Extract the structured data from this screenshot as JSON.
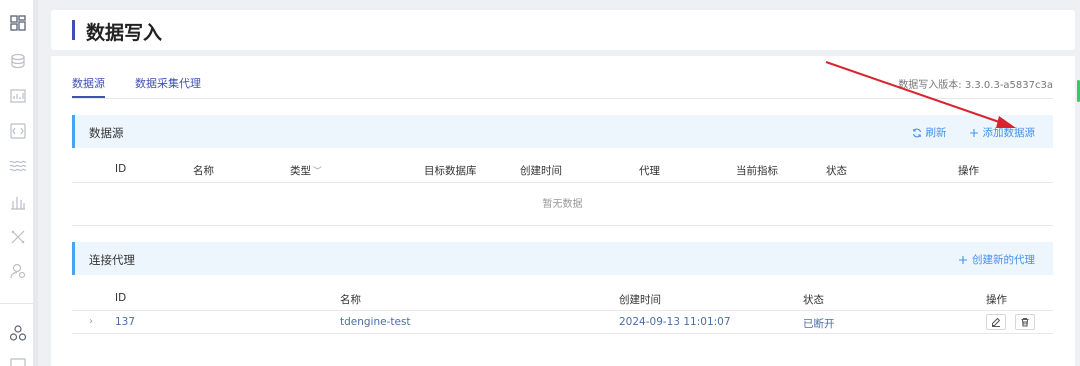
{
  "header": {
    "title": "数据写入"
  },
  "tabs": [
    {
      "label": "数据源",
      "active": true
    },
    {
      "label": "数据采集代理",
      "active": false
    }
  ],
  "version_text": "数据写入版本: 3.3.0.3-a5837c3a",
  "datasource": {
    "title": "数据源",
    "refresh_label": "刷新",
    "add_label": "添加数据源",
    "columns": [
      "ID",
      "名称",
      "类型",
      "目标数据库",
      "创建时间",
      "代理",
      "当前指标",
      "状态",
      "操作"
    ],
    "empty_text": "暂无数据"
  },
  "agents": {
    "title": "连接代理",
    "create_label": "创建新的代理",
    "columns": [
      "ID",
      "名称",
      "创建时间",
      "状态",
      "操作"
    ],
    "rows": [
      {
        "id": "137",
        "name": "tdengine-test",
        "created": "2024-09-13 11:01:07",
        "status": "已断开"
      }
    ]
  },
  "colors": {
    "accent": "#3f51b5",
    "link": "#4a8ff0",
    "section_bg": "#eef6fd",
    "annotation_arrow": "#d9232d"
  },
  "icons": {
    "rail": [
      "dashboard-icon",
      "database-icon",
      "chart-icon",
      "explorer-icon",
      "stream-icon",
      "data-in-icon",
      "tools-icon",
      "user-icon",
      "cluster-icon",
      "monitor-icon"
    ],
    "actions": [
      "refresh-icon",
      "plus-icon",
      "edit-icon",
      "delete-icon"
    ]
  }
}
